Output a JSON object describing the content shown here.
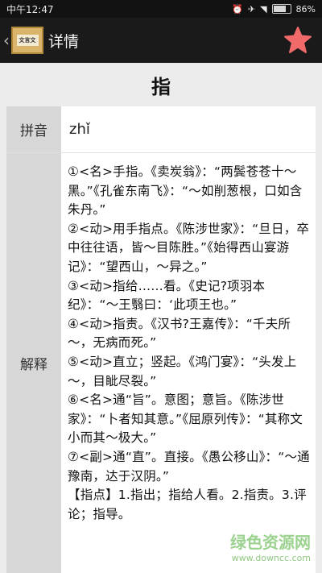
{
  "status_bar": {
    "time": "中午12:47",
    "battery_text": "86%",
    "battery_level": 0.86
  },
  "header": {
    "back_icon": "chevron-left-icon",
    "app_icon_text": "文言文",
    "title": "详情",
    "favorite_icon": "star-icon",
    "favorite_color": "#f06a6a"
  },
  "word": "指",
  "table": {
    "pinyin_label": "拼音",
    "pinyin_value": "zhǐ",
    "definition_label": "解释",
    "definition_text": "①<名>手指。《卖炭翁》：“两鬓苍苍十～黑。”《孔雀东南飞》：“～如削葱根，口如含朱丹。”\n②<动>用手指点。《陈涉世家》：“旦日，卒中往往语，皆～目陈胜。”《始得西山宴游记》：“望西山，～异之。”\n③<动>指给……看。《史记?项羽本纪》：“～王翳曰：‘此项王也。”\n④<动>指责。《汉书?王嘉传》：“千夫所～，无病而死。”\n⑤<动>直立；竖起。《鸿门宴》：“头发上～，目眦尽裂。”\n⑥<名>通“旨”。意图；意旨。《陈涉世家》：“卜者知其意。”《屈原列传》：“其称文小而其～极大。”\n⑦<副>通“直”。直接。《愚公移山》：“～通豫南，达于汉阴。”\n【指点】1.指出；指给人看。2.指责。3.评论；指导。"
  },
  "watermark": {
    "main": "绿色资源网",
    "sub": "www.downcc.com"
  }
}
